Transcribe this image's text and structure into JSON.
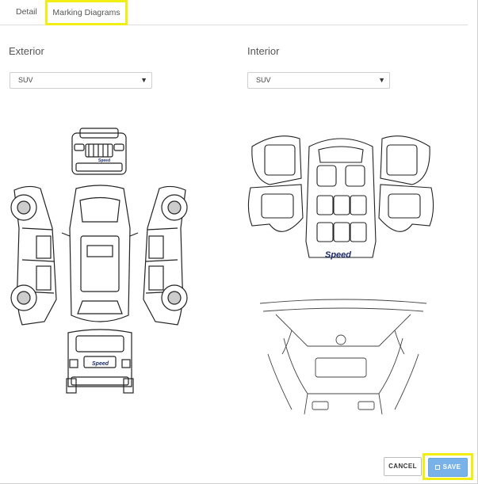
{
  "tabs": [
    {
      "label": "Detail"
    },
    {
      "label": "Marking Diagrams",
      "active": true
    }
  ],
  "exterior": {
    "label": "Exterior",
    "select_value": "SUV",
    "brand": "Speed"
  },
  "interior": {
    "label": "Interior",
    "select_value": "SUV",
    "brand": "Speed"
  },
  "actions": {
    "cancel_label": "CANCEL",
    "save_label": "SAVE"
  },
  "icons": {
    "caret": "chevron-down-icon",
    "save": "floppy-disk-icon"
  },
  "colors": {
    "highlight": "#f0ee12",
    "save_button": "#78b2e8"
  }
}
